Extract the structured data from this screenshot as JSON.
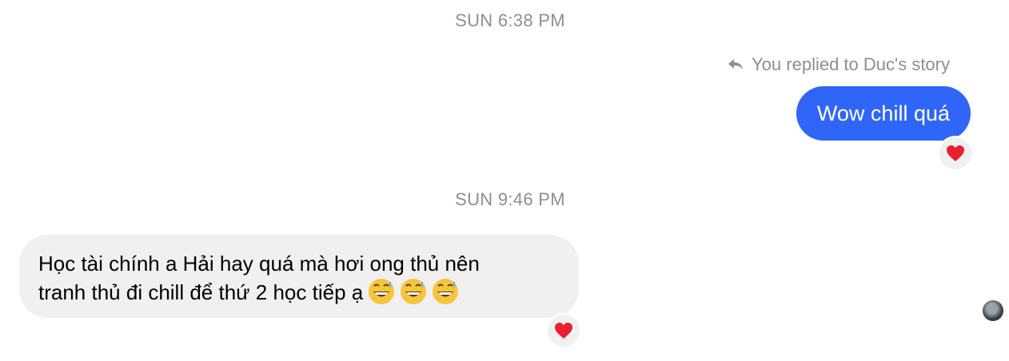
{
  "timestamps": [
    "SUN 6:38 PM",
    "SUN 9:46 PM"
  ],
  "outgoing": {
    "reply_context": "You replied to Duc's story",
    "reply_icon": "reply-arrow-icon",
    "message": "Wow chill quá",
    "bubble_color": "#3066f7",
    "reaction": "❤️"
  },
  "incoming": {
    "line1": "Học tài chính a Hải hay quá mà hơi ong thủ nên",
    "line2": "tranh thủ đi chill để thứ 2 học tiếp ạ",
    "emojis": [
      "😅",
      "😅",
      "😅"
    ],
    "reaction": "❤️"
  },
  "read_receipt": {
    "icon": "avatar"
  }
}
